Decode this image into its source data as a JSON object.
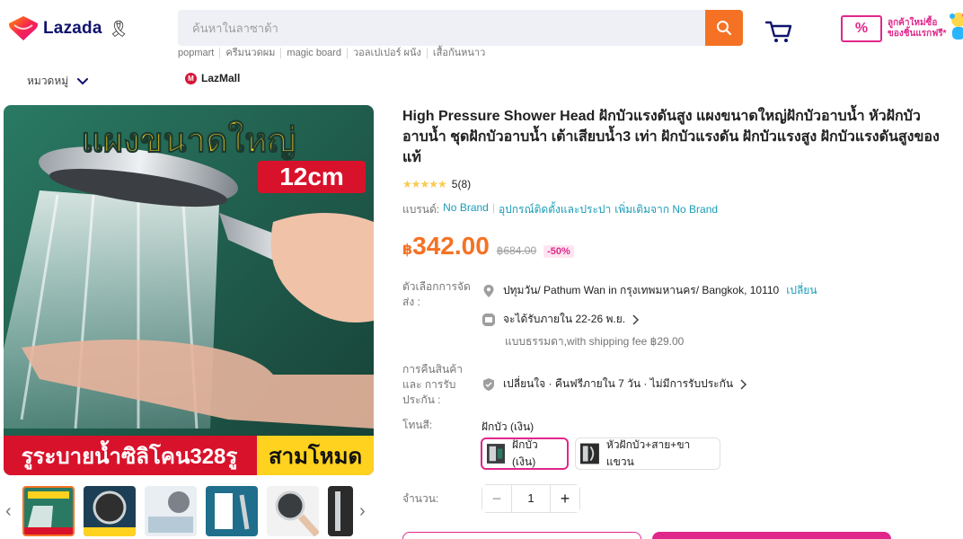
{
  "header": {
    "logo_text": "Lazada",
    "search_placeholder": "ค้นหาในลาซาด้า",
    "suggestions": [
      "popmart",
      "ครีมนวดผม",
      "magic board",
      "วอลเปเปอร์ ผนัง",
      "เสื้อกันหนาว"
    ],
    "promo_text_line1": "ลูกค้าใหม่ซื้อ",
    "promo_text_line2": "ของชิ้นแรกฟรี*",
    "promo_badge": "%"
  },
  "subnav": {
    "category_label": "หมวดหมู่",
    "lazmall_label": "LazMall"
  },
  "gallery": {
    "banner_top": "แผงขนาดใหญ่",
    "size_badge": "12cm",
    "banner_bottom_left": "รูระบายน้ำซิลิโคน328รู",
    "banner_bottom_right": "สามโหมด"
  },
  "product": {
    "title": "High Pressure Shower Head ฝักบัวแรงดันสูง แผงขนาดใหญ่ฝักบัวอาบน้ำ หัวฝักบัวอาบน้ำ ชุดฝักบัวอาบน้ำ เต้าเสียบน้ำ3 เท่า ฝักบัวแรงดัน ฝักบัวแรงสูง ฝักบัวแรงดันสูงของแท้",
    "rating_stars": "★★★★★",
    "rating_count": "5(8)",
    "brand_label": "แบรนด์:",
    "brand_value": "No Brand",
    "category_link": "อุปกรณ์ติดตั้งและประปา",
    "more_from": "เพิ่มเติมจาก No Brand",
    "price_currency": "฿",
    "price_value": "342.00",
    "original_price": "฿684.00",
    "discount": "-50%"
  },
  "delivery": {
    "label": "ตัวเลือกการจัดส่ง :",
    "location": "ปทุมวัน/ Pathum Wan in กรุงเทพมหานคร/ Bangkok, 10110",
    "change_link": "เปลี่ยน",
    "eta": "จะได้รับภายใน 22-26 พ.ย.",
    "shipping_note": "แบบธรรมดา,with shipping fee ฿29.00"
  },
  "returns": {
    "label": "การคืนสินค้าและ การรับประกัน :",
    "policy": "เปลี่ยนใจ · คืนฟรีภายใน 7 วัน · ไม่มีการรับประกัน"
  },
  "color": {
    "label": "โทนสี:",
    "selected_name": "ฝักบัว (เงิน)",
    "options": [
      "ฝักบัว (เงิน)",
      "หัวฝักบัว+สาย+ขาแขวน"
    ]
  },
  "quantity": {
    "label": "จำนวน:",
    "value": "1",
    "minus": "−",
    "plus": "+"
  },
  "colors": {
    "brand_orange": "#f57224",
    "brand_pink": "#e0288b",
    "link_blue": "#1a9cb7",
    "banner_green": "#1f5b4a",
    "banner_yellow": "#ffd21f",
    "banner_red": "#d9122b"
  }
}
